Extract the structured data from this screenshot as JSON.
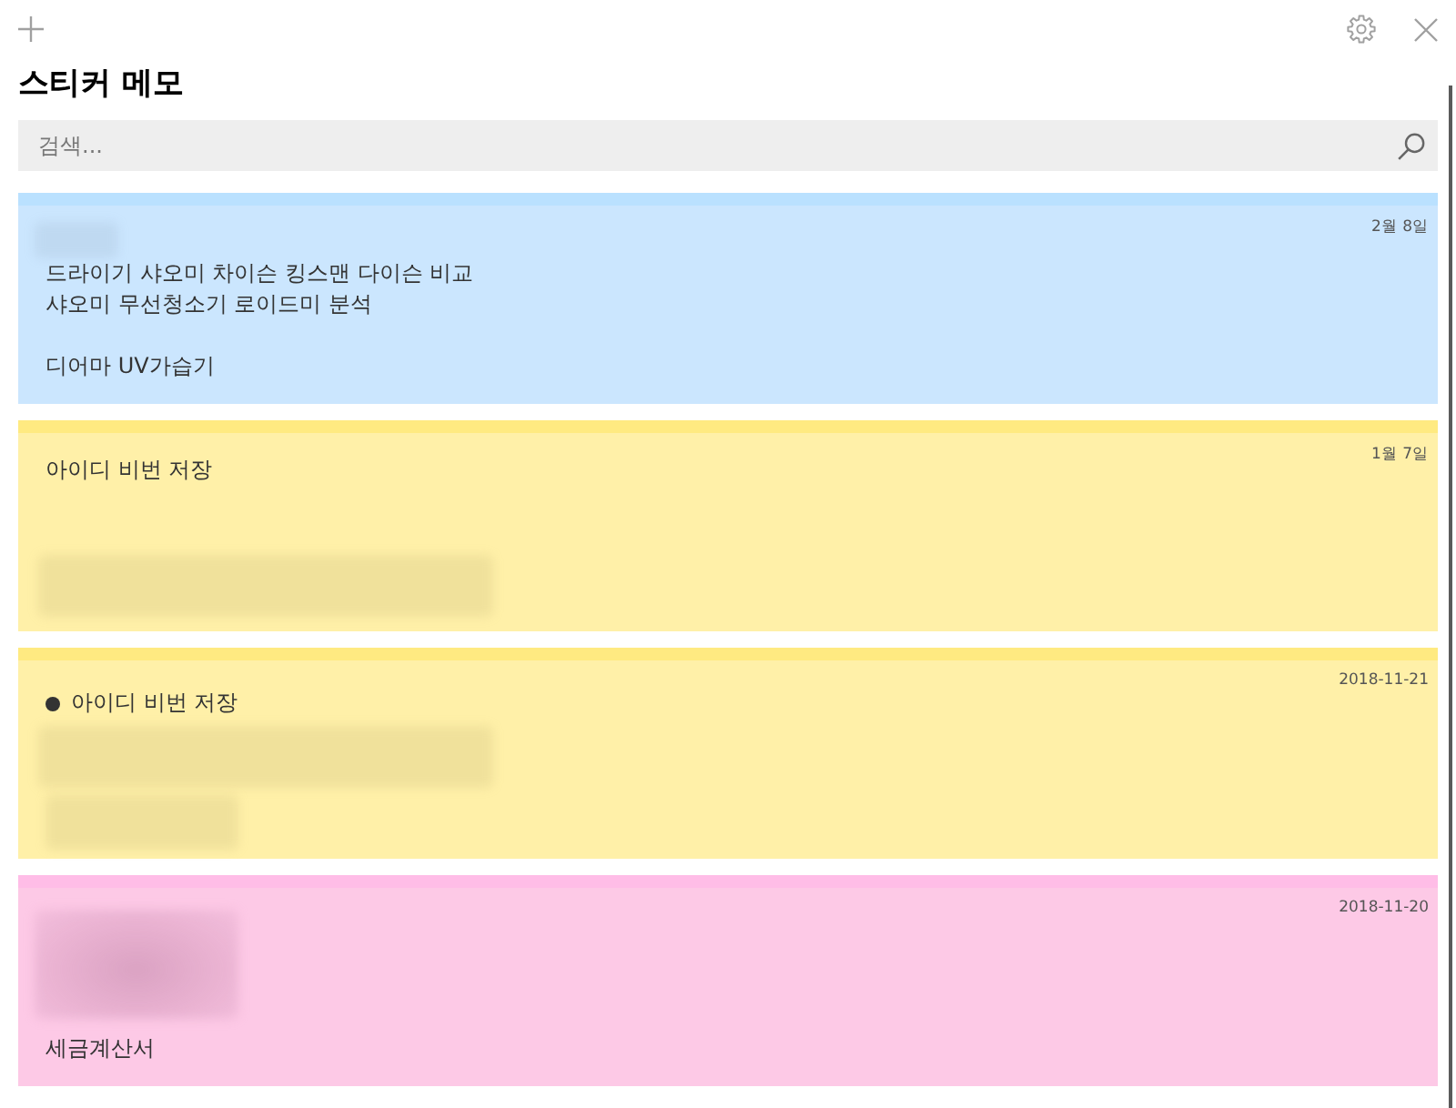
{
  "app": {
    "title": "스티커 메모"
  },
  "search": {
    "placeholder": "검색..."
  },
  "notes": [
    {
      "color": "#cbe6fe",
      "date": "2월 8일",
      "content": [
        {
          "kind": "blur_small"
        },
        {
          "kind": "text",
          "text": "드라이기 샤오미 차이슨 킹스맨 다이슨 비교"
        },
        {
          "kind": "text",
          "text": "샤오미 무선청소기 로이드미 분석"
        },
        {
          "kind": "gap"
        },
        {
          "kind": "text",
          "text": "디어마 UV가습기"
        }
      ]
    },
    {
      "color": "#fff0a8",
      "date": "1월 7일",
      "content": [
        {
          "kind": "text",
          "text": "아이디 비번 저장"
        },
        {
          "kind": "gap"
        },
        {
          "kind": "gap"
        },
        {
          "kind": "blur_wide"
        }
      ]
    },
    {
      "color": "#fff0a8",
      "date": "2018-11-21",
      "content": [
        {
          "kind": "bullet",
          "text": "아이디 비번 저장"
        },
        {
          "kind": "blur_wide"
        },
        {
          "kind": "blur_short"
        }
      ]
    },
    {
      "color": "#fdc9e6",
      "date": "2018-11-20",
      "content": [
        {
          "kind": "blur_image"
        },
        {
          "kind": "text",
          "text": "세금계산서"
        }
      ]
    }
  ]
}
